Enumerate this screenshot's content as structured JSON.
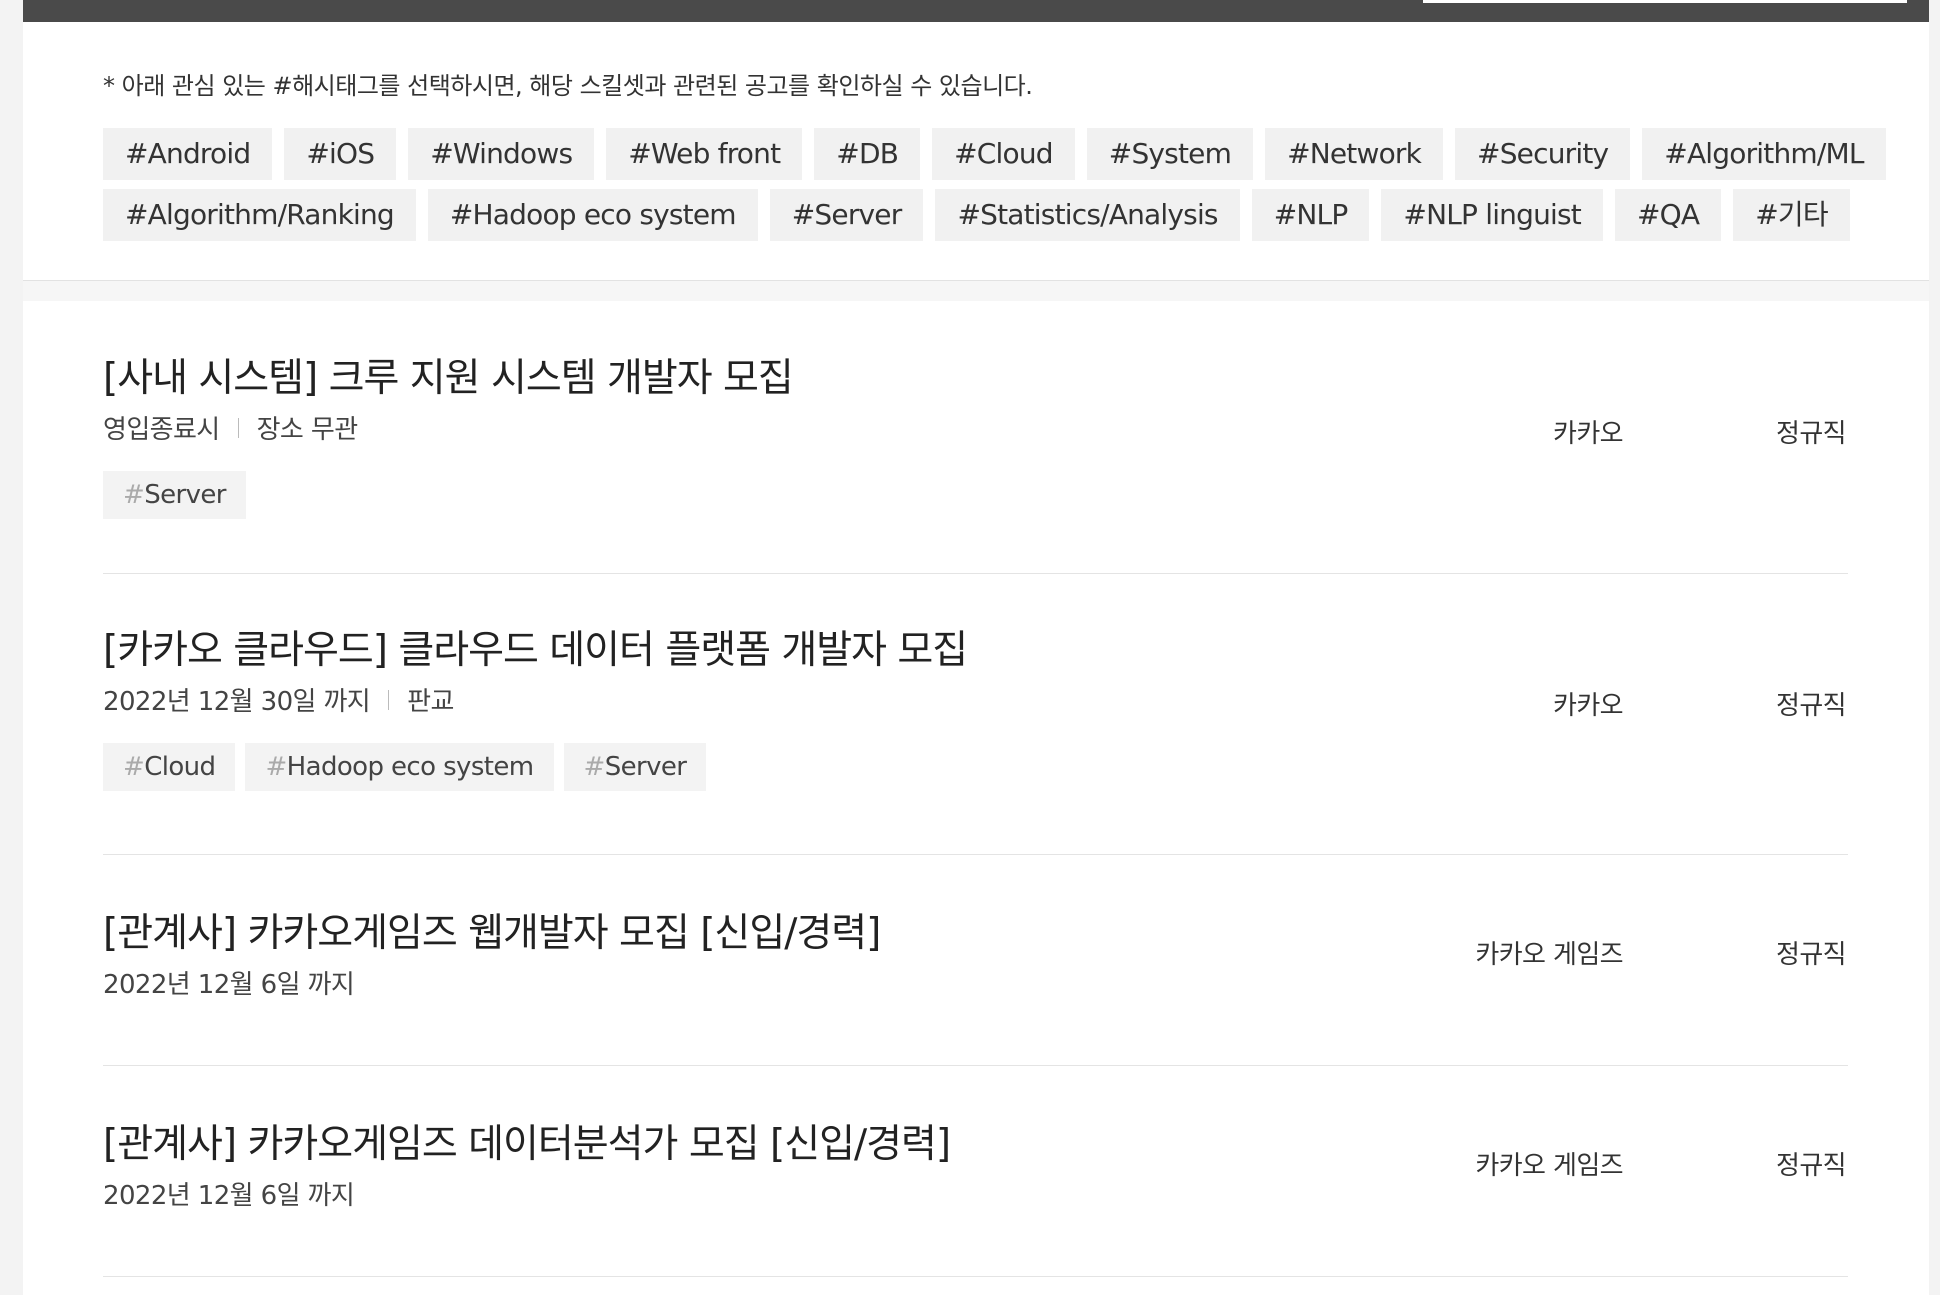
{
  "filter": {
    "notice": "* 아래 관심 있는 #해시태그를 선택하시면, 해당 스킬셋과 관련된 공고를 확인하실 수 있습니다.",
    "row1": [
      "#Android",
      "#iOS",
      "#Windows",
      "#Web front",
      "#DB",
      "#Cloud",
      "#System",
      "#Network",
      "#Security",
      "#Algorithm/ML"
    ],
    "row2": [
      "#Algorithm/Ranking",
      "#Hadoop eco system",
      "#Server",
      "#Statistics/Analysis",
      "#NLP",
      "#NLP linguist",
      "#QA",
      "#기타"
    ]
  },
  "jobs": [
    {
      "title": "[사내 시스템] 크루 지원 시스템 개발자 모집",
      "deadline": "영입종료시",
      "location": "장소 무관",
      "tags": [
        "Server"
      ],
      "company": "카카오",
      "type": "정규직"
    },
    {
      "title": "[카카오 클라우드] 클라우드 데이터 플랫폼 개발자 모집",
      "deadline": "2022년 12월 30일 까지",
      "location": "판교",
      "tags": [
        "Cloud",
        "Hadoop eco system",
        "Server"
      ],
      "company": "카카오",
      "type": "정규직"
    },
    {
      "title": "[관계사] 카카오게임즈 웹개발자 모집 [신입/경력]",
      "deadline": "2022년 12월 6일 까지",
      "company": "카카오 게임즈",
      "type": "정규직"
    },
    {
      "title": "[관계사] 카카오게임즈 데이터분석가 모집 [신입/경력]",
      "deadline": "2022년 12월 6일 까지",
      "company": "카카오 게임즈",
      "type": "정규직"
    }
  ]
}
